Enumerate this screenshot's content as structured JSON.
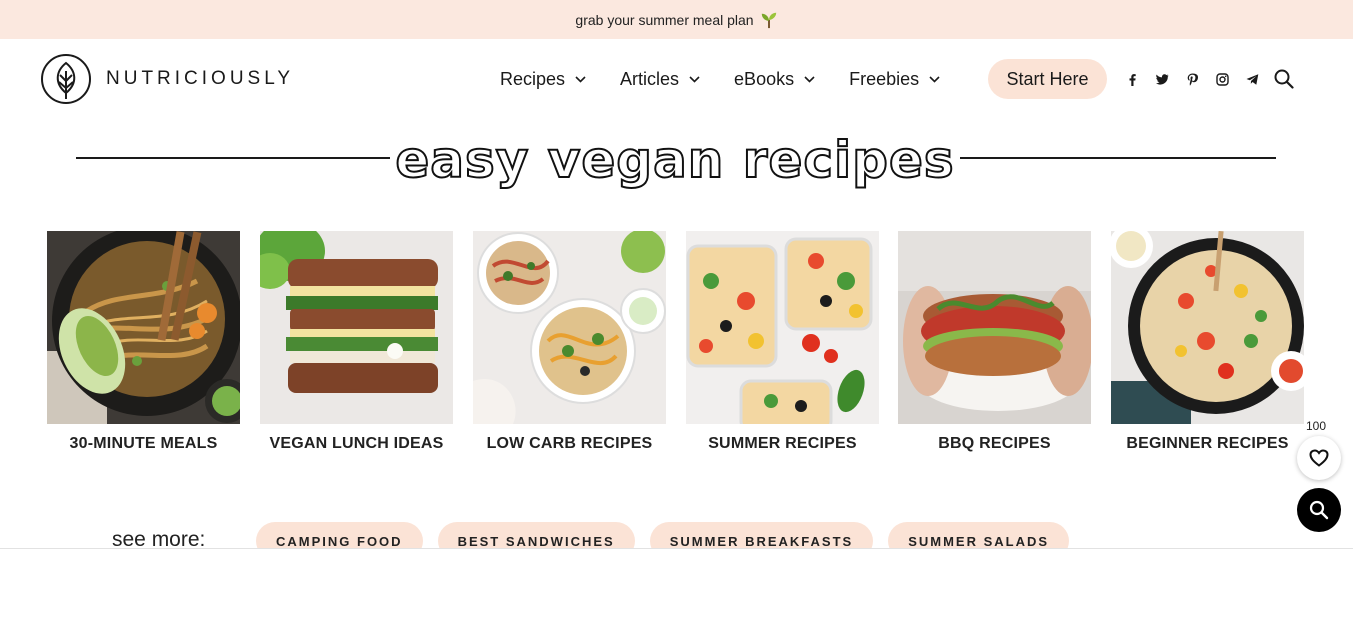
{
  "topbar": {
    "text": "grab your summer meal plan",
    "icon": "sprout-icon"
  },
  "logo": {
    "text": "NUTRICIOUSLY"
  },
  "nav": {
    "items": [
      {
        "label": "Recipes"
      },
      {
        "label": "Articles"
      },
      {
        "label": "eBooks"
      },
      {
        "label": "Freebies"
      }
    ],
    "start_label": "Start Here",
    "social": [
      "facebook-icon",
      "twitter-icon",
      "pinterest-icon",
      "instagram-icon",
      "telegram-icon"
    ]
  },
  "section": {
    "title": "easy vegan recipes"
  },
  "cards": [
    {
      "label": "30-MINUTE MEALS"
    },
    {
      "label": "VEGAN LUNCH IDEAS"
    },
    {
      "label": "LOW CARB RECIPES"
    },
    {
      "label": "SUMMER RECIPES"
    },
    {
      "label": "BBQ RECIPES"
    },
    {
      "label": "BEGINNER RECIPES"
    }
  ],
  "see_more": {
    "label": "see more:",
    "tags": [
      "CAMPING FOOD",
      "BEST SANDWICHES",
      "SUMMER BREAKFASTS",
      "SUMMER SALADS"
    ]
  },
  "floating": {
    "favorite_count": "100"
  },
  "colors": {
    "peach": "#fbe3d6",
    "topbar": "#fbe8df",
    "text": "#1a1a1a"
  }
}
